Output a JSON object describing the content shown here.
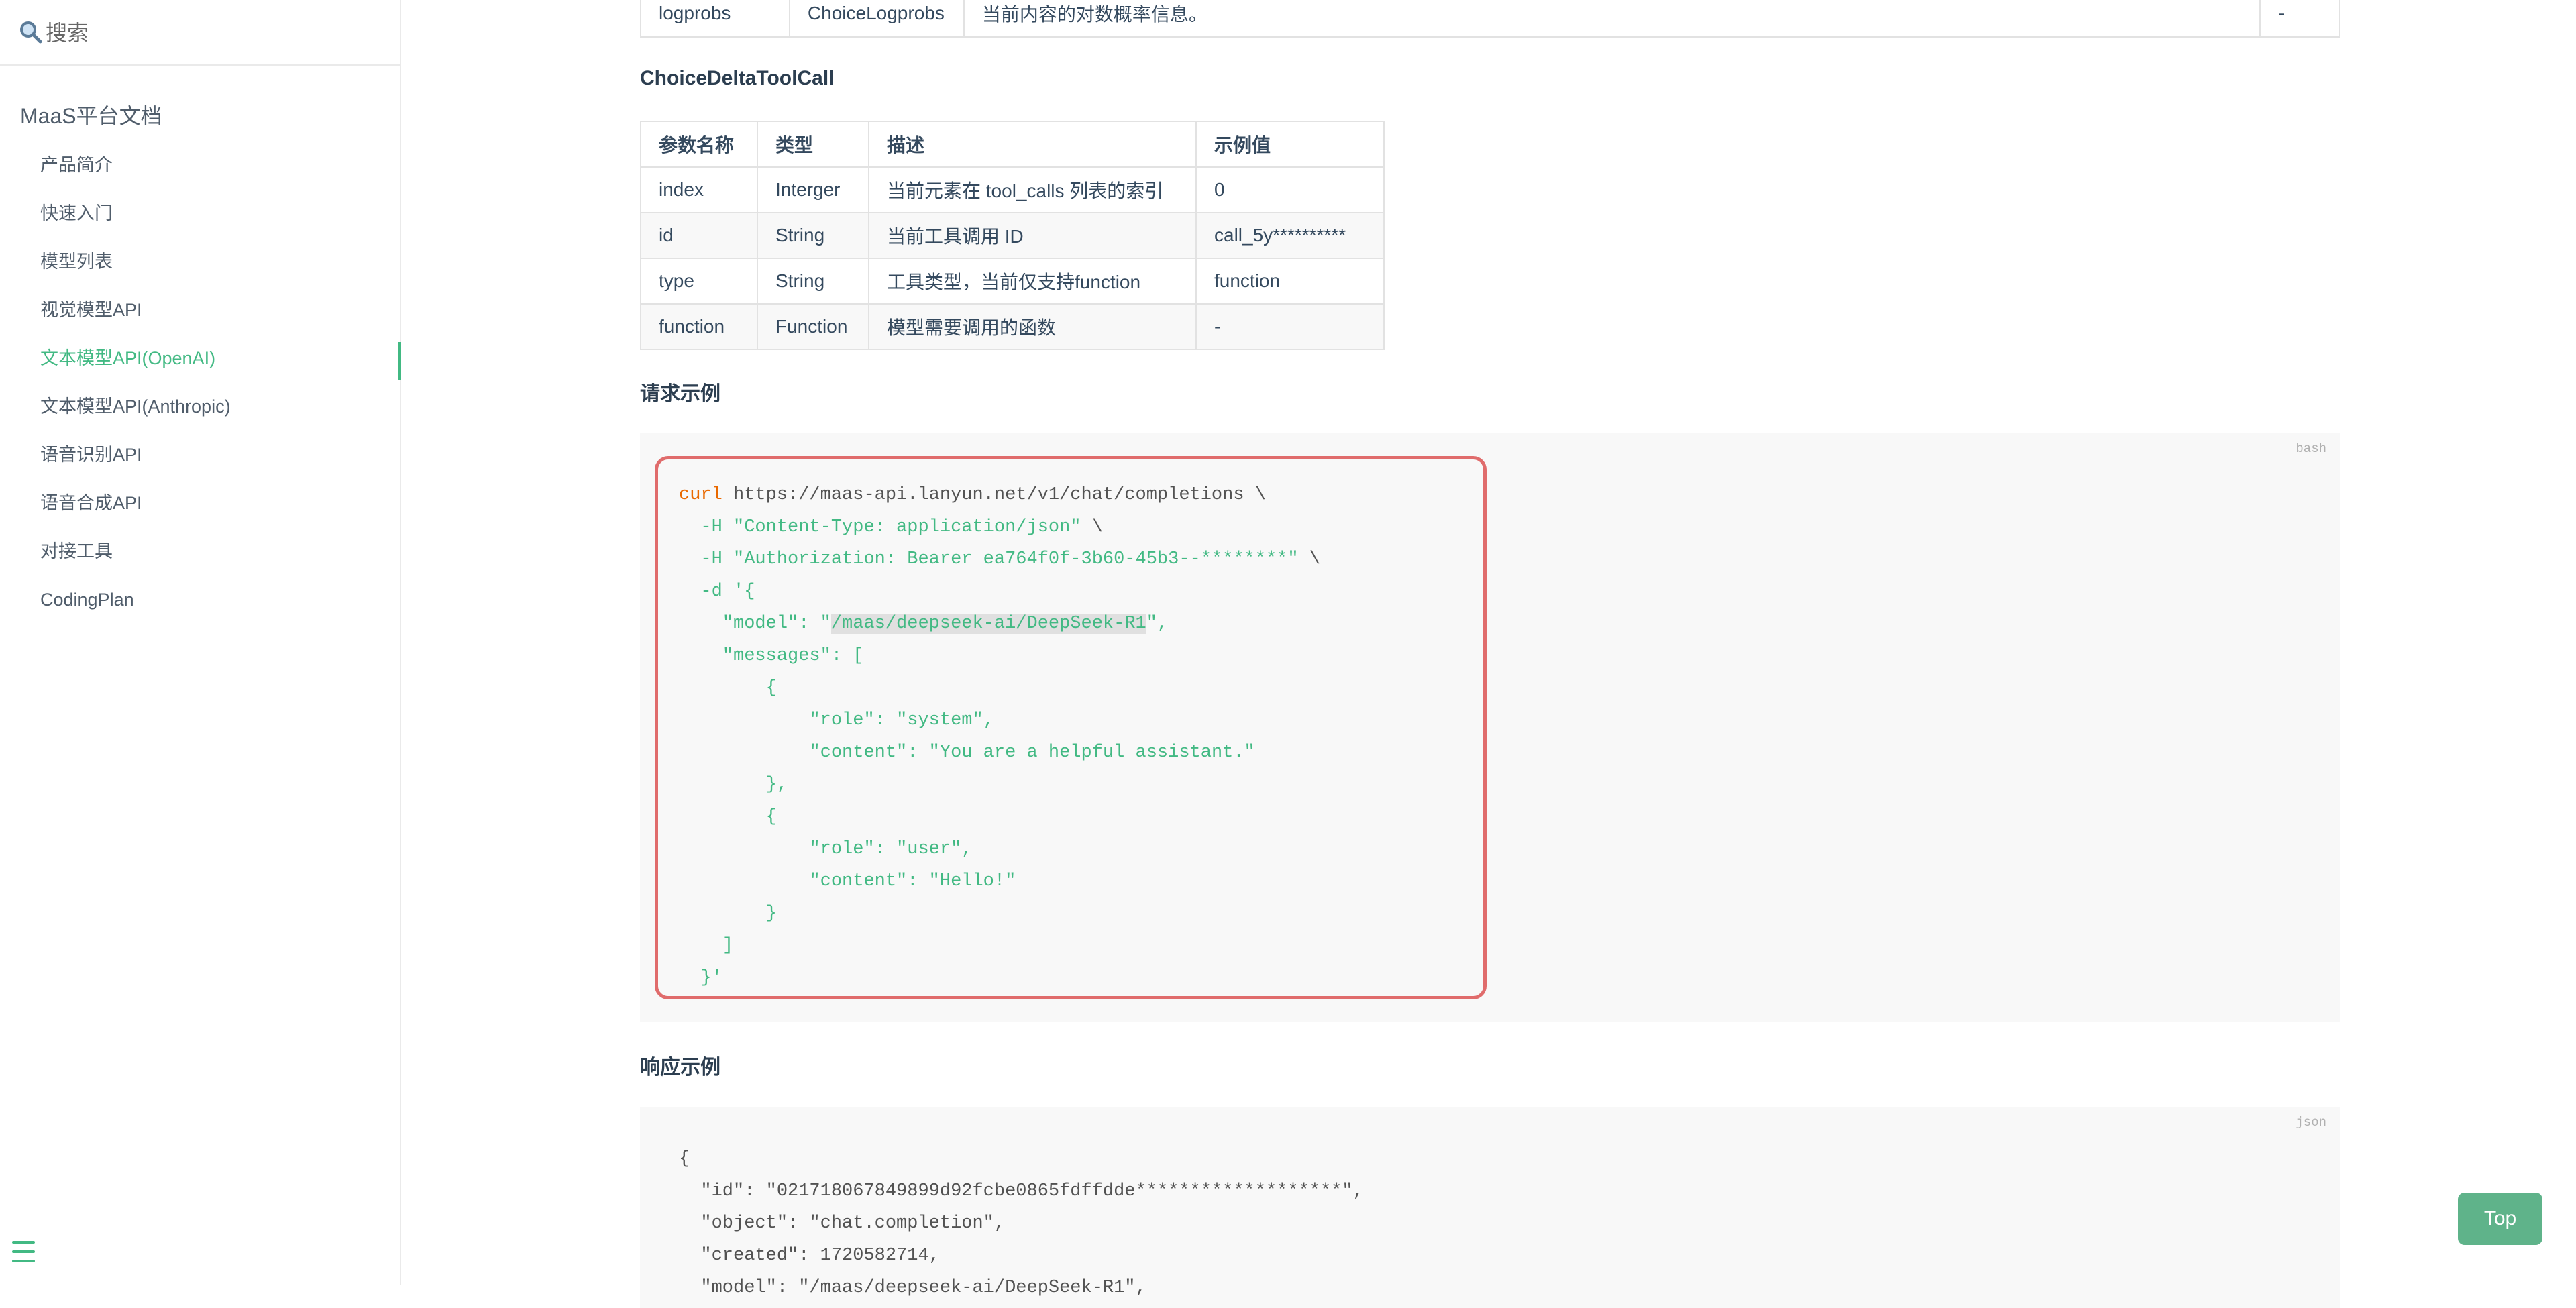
{
  "sidebar": {
    "search": {
      "placeholder": "搜索"
    },
    "title": "MaaS平台文档",
    "items": [
      {
        "label": "产品简介"
      },
      {
        "label": "快速入门"
      },
      {
        "label": "模型列表"
      },
      {
        "label": "视觉模型API"
      },
      {
        "label": "文本模型API(OpenAI)",
        "active": true
      },
      {
        "label": "文本模型API(Anthropic)"
      },
      {
        "label": "语音识别API"
      },
      {
        "label": "语音合成API"
      },
      {
        "label": "对接工具"
      },
      {
        "label": "CodingPlan"
      }
    ]
  },
  "top_table_row": {
    "name": "logprobs",
    "type": "ChoiceLogprobs",
    "desc": "当前内容的对数概率信息。",
    "example": "-"
  },
  "tool_call_section": {
    "title": "ChoiceDeltaToolCall",
    "headers": [
      "参数名称",
      "类型",
      "描述",
      "示例值"
    ],
    "rows": [
      [
        "index",
        "Interger",
        "当前元素在 tool_calls 列表的索引",
        "0"
      ],
      [
        "id",
        "String",
        "当前工具调用 ID",
        "call_5y**********"
      ],
      [
        "type",
        "String",
        "工具类型，当前仅支持function",
        "function"
      ],
      [
        "function",
        "Function",
        "模型需要调用的函数",
        "-"
      ]
    ]
  },
  "request_example": {
    "title": "请求示例",
    "lang": "bash",
    "cmd": "curl",
    "url": " https://maas-api.lanyun.net/v1/chat/completions \\",
    "h1_flag": "-H",
    "h1_val": "\"Content-Type: application/json\"",
    "h2_flag": "-H",
    "h2_val": "\"Authorization: Bearer ea764f0f-3b60-45b3--********\"",
    "d_flag": "-d",
    "model_key": "\"model\"",
    "model_val": "/maas/deepseek-ai/DeepSeek-R1",
    "messages_key": "\"messages\"",
    "role_key": "\"role\"",
    "content_key": "\"content\"",
    "role1": "\"system\"",
    "content1": "\"You are a helpful assistant.\"",
    "role2": "\"user\"",
    "content2": "\"Hello!\""
  },
  "response_example": {
    "title": "响应示例",
    "lang": "json",
    "id_key": "\"id\"",
    "id_val": "\"021718067849899d92fcbe0865fdffdde*******************\"",
    "object_key": "\"object\"",
    "object_val": "\"chat.completion\"",
    "created_key": "\"created\"",
    "created_val": "1720582714",
    "model_partial": "\"model\": \"/maas/deepseek-ai/DeepSeek-R1\","
  },
  "top_button": {
    "label": "Top"
  },
  "colors": {
    "accent": "#42b983",
    "highlight_border": "#e06c6c",
    "top_button": "#5fb38a"
  }
}
